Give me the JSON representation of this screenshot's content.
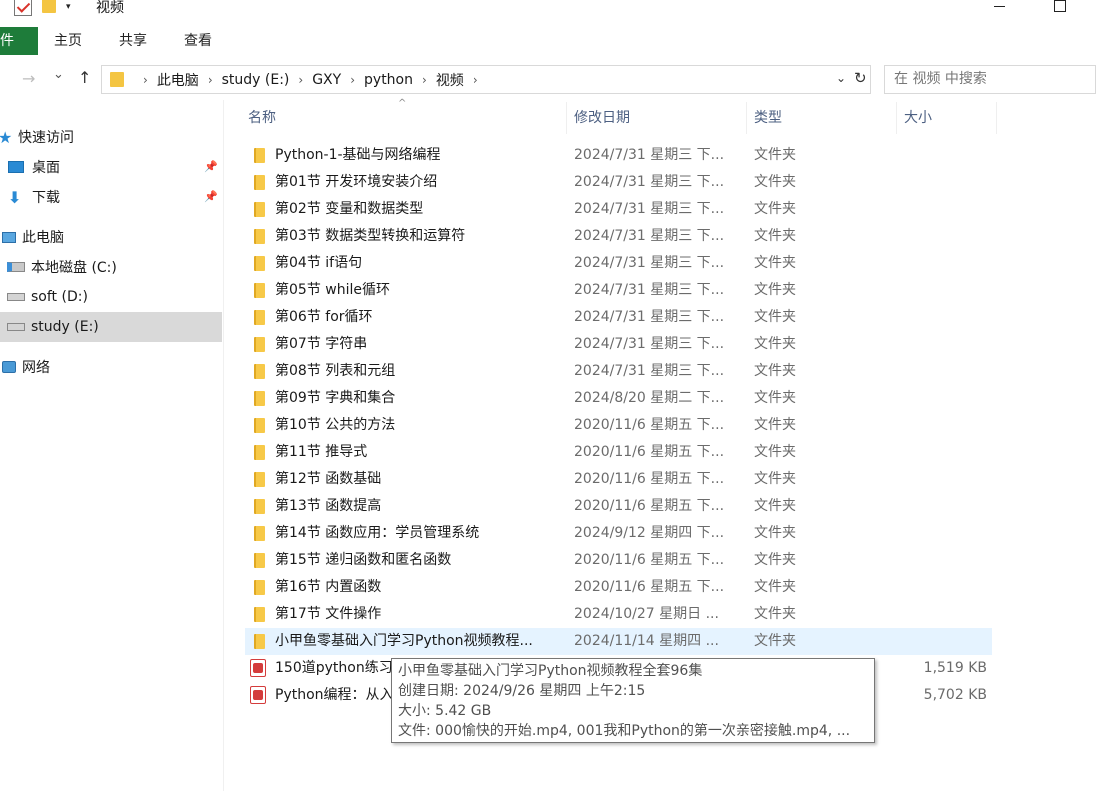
{
  "window": {
    "title": "视频",
    "qa_dropdown_glyph": "▾"
  },
  "ribbon": {
    "file_tab": "件",
    "tabs": [
      "主页",
      "共享",
      "查看"
    ]
  },
  "address": {
    "crumbs": [
      "此电脑",
      "study (E:)",
      "GXY",
      "python",
      "视频"
    ],
    "separator": "›",
    "search_placeholder": "在 视频 中搜索"
  },
  "nav_icons": {
    "back": "→",
    "forward_drop": "⌄",
    "up": "↑",
    "refresh": "↻",
    "dropdown": "⌄",
    "sort": "^",
    "pin": "📌"
  },
  "navpane": {
    "items": [
      {
        "label": "快速访问",
        "icon": "star-icon"
      },
      {
        "label": "桌面",
        "icon": "desktop-icon",
        "pinned": true
      },
      {
        "label": "下载",
        "icon": "download-icon",
        "pinned": true
      },
      {
        "label": "此电脑",
        "icon": "computer-icon"
      },
      {
        "label": "本地磁盘 (C:)",
        "icon": "drive-icon"
      },
      {
        "label": "soft (D:)",
        "icon": "drive-icon"
      },
      {
        "label": "study (E:)",
        "icon": "drive-icon",
        "selected": true
      },
      {
        "label": "网络",
        "icon": "network-icon"
      }
    ]
  },
  "columns": {
    "name": "名称",
    "date": "修改日期",
    "type": "类型",
    "size": "大小"
  },
  "files": [
    {
      "name": "Python-1-基础与网络编程",
      "date": "2024/7/31 星期三 下...",
      "type": "文件夹",
      "size": "",
      "kind": "folder"
    },
    {
      "name": "第01节 开发环境安装介绍",
      "date": "2024/7/31 星期三 下...",
      "type": "文件夹",
      "size": "",
      "kind": "folder"
    },
    {
      "name": "第02节 变量和数据类型",
      "date": "2024/7/31 星期三 下...",
      "type": "文件夹",
      "size": "",
      "kind": "folder"
    },
    {
      "name": "第03节 数据类型转换和运算符",
      "date": "2024/7/31 星期三 下...",
      "type": "文件夹",
      "size": "",
      "kind": "folder"
    },
    {
      "name": "第04节 if语句",
      "date": "2024/7/31 星期三 下...",
      "type": "文件夹",
      "size": "",
      "kind": "folder"
    },
    {
      "name": "第05节 while循环",
      "date": "2024/7/31 星期三 下...",
      "type": "文件夹",
      "size": "",
      "kind": "folder"
    },
    {
      "name": "第06节 for循环",
      "date": "2024/7/31 星期三 下...",
      "type": "文件夹",
      "size": "",
      "kind": "folder"
    },
    {
      "name": "第07节 字符串",
      "date": "2024/7/31 星期三 下...",
      "type": "文件夹",
      "size": "",
      "kind": "folder"
    },
    {
      "name": "第08节 列表和元组",
      "date": "2024/7/31 星期三 下...",
      "type": "文件夹",
      "size": "",
      "kind": "folder"
    },
    {
      "name": "第09节 字典和集合",
      "date": "2024/8/20 星期二 下...",
      "type": "文件夹",
      "size": "",
      "kind": "folder"
    },
    {
      "name": "第10节 公共的方法",
      "date": "2020/11/6 星期五 下...",
      "type": "文件夹",
      "size": "",
      "kind": "folder"
    },
    {
      "name": "第11节 推导式",
      "date": "2020/11/6 星期五 下...",
      "type": "文件夹",
      "size": "",
      "kind": "folder"
    },
    {
      "name": "第12节 函数基础",
      "date": "2020/11/6 星期五 下...",
      "type": "文件夹",
      "size": "",
      "kind": "folder"
    },
    {
      "name": "第13节 函数提高",
      "date": "2020/11/6 星期五 下...",
      "type": "文件夹",
      "size": "",
      "kind": "folder"
    },
    {
      "name": "第14节 函数应用：学员管理系统",
      "date": "2024/9/12 星期四 下...",
      "type": "文件夹",
      "size": "",
      "kind": "folder"
    },
    {
      "name": "第15节 递归函数和匿名函数",
      "date": "2020/11/6 星期五 下...",
      "type": "文件夹",
      "size": "",
      "kind": "folder"
    },
    {
      "name": "第16节 内置函数",
      "date": "2020/11/6 星期五 下...",
      "type": "文件夹",
      "size": "",
      "kind": "folder"
    },
    {
      "name": "第17节 文件操作",
      "date": "2024/10/27 星期日 ...",
      "type": "文件夹",
      "size": "",
      "kind": "folder"
    },
    {
      "name": "小甲鱼零基础入门学习Python视频教程...",
      "date": "2024/11/14 星期四 ...",
      "type": "文件夹",
      "size": "",
      "kind": "folder",
      "hover": true
    },
    {
      "name": "150道python练习",
      "date": "",
      "type": "",
      "size": "1,519 KB",
      "kind": "pdf"
    },
    {
      "name": "Python编程：从入",
      "date": "",
      "type": "",
      "size": "5,702 KB",
      "kind": "pdf"
    }
  ],
  "tooltip": {
    "line1": "小甲鱼零基础入门学习Python视频教程全套96集",
    "line2": "创建日期: 2024/9/26 星期四 上午2:15",
    "line3": "大小: 5.42 GB",
    "line4": "文件: 000愉快的开始.mp4, 001我和Python的第一次亲密接触.mp4, ..."
  }
}
